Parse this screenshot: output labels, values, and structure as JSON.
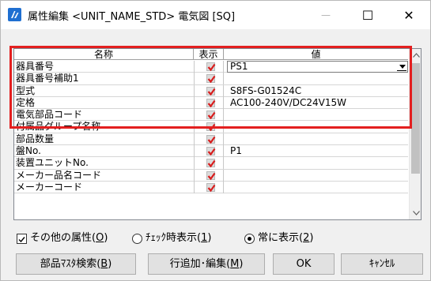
{
  "window": {
    "title": "属性編集 <UNIT_NAME_STD> 電気図 [SQ]",
    "icon": "app-logo-icon",
    "controls": {
      "minimize": "—",
      "maximize": "☐",
      "close": "✕"
    }
  },
  "grid": {
    "columns": {
      "name": "名称",
      "show": "表示",
      "value": "値"
    },
    "rows": [
      {
        "name": "器具番号",
        "checked": true,
        "value": "PS1",
        "editing": true
      },
      {
        "name": "器具番号補助1",
        "checked": true,
        "value": ""
      },
      {
        "name": "型式",
        "checked": true,
        "value": "S8FS-G01524C"
      },
      {
        "name": "定格",
        "checked": true,
        "value": "AC100-240V/DC24V15W"
      },
      {
        "name": "電気部品コード",
        "checked": true,
        "value": ""
      },
      {
        "name": "付属品グループ名称",
        "checked": true,
        "value": ""
      },
      {
        "name": "部品数量",
        "checked": true,
        "value": ""
      },
      {
        "name": "盤No.",
        "checked": true,
        "value": "P1"
      },
      {
        "name": "装置ユニットNo.",
        "checked": true,
        "value": ""
      },
      {
        "name": "メーカー品名コード",
        "checked": true,
        "value": ""
      },
      {
        "name": "メーカーコード",
        "checked": true,
        "value": ""
      }
    ]
  },
  "options": {
    "other_attrs": {
      "label": "その他の属性(",
      "key": "O",
      "suffix": ")",
      "checked": true
    },
    "radio_checked_display": {
      "label": "ﾁｪｯｸ時表示(",
      "key": "1",
      "suffix": ")",
      "selected": false
    },
    "radio_always_display": {
      "label": "常に表示(",
      "key": "2",
      "suffix": ")",
      "selected": true
    }
  },
  "buttons": {
    "parts_search": {
      "label": "部品ﾏｽﾀ検索(",
      "key": "B",
      "suffix": ")"
    },
    "add_edit_row": {
      "label": "行追加･編集(",
      "key": "M",
      "suffix": ")"
    },
    "ok": {
      "label": "OK"
    },
    "cancel": {
      "label": "ｷｬﾝｾﾙ"
    }
  },
  "colors": {
    "highlight": "#e31f1f",
    "check": "#d91c1c",
    "accent": "#1f6fd1"
  }
}
